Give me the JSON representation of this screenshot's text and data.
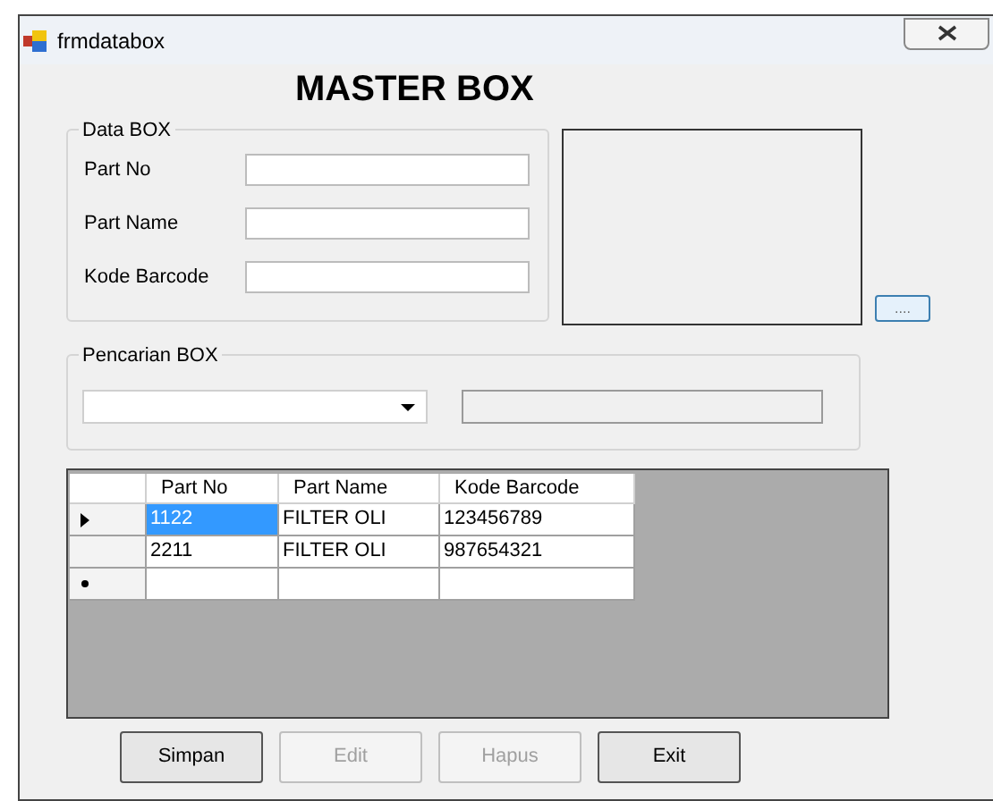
{
  "window": {
    "title": "frmdatabox"
  },
  "heading": "MASTER BOX",
  "data_group": {
    "title": "Data BOX",
    "fields": [
      {
        "label": "Part No"
      },
      {
        "label": "Part Name"
      },
      {
        "label": "Kode Barcode"
      }
    ]
  },
  "browse_button": "....",
  "search_group": {
    "title": "Pencarian BOX",
    "text_disabled": true
  },
  "grid": {
    "columns": [
      "Part No",
      "Part Name",
      "Kode Barcode"
    ],
    "rows": [
      {
        "current": true,
        "new": false,
        "cells": [
          {
            "text": "1122",
            "selected": true
          },
          {
            "text": "FILTER OLI",
            "selected": false
          },
          {
            "text": "123456789",
            "selected": false
          }
        ]
      },
      {
        "current": false,
        "new": false,
        "cells": [
          {
            "text": "2211",
            "selected": false
          },
          {
            "text": "FILTER OLI",
            "selected": false
          },
          {
            "text": "987654321",
            "selected": false
          }
        ]
      },
      {
        "current": false,
        "new": true,
        "cells": [
          {
            "selected": false
          },
          {
            "selected": false
          },
          {
            "selected": false
          }
        ]
      }
    ]
  },
  "buttons": [
    {
      "label": "Simpan",
      "disabled": false
    },
    {
      "label": "Edit",
      "disabled": true
    },
    {
      "label": "Hapus",
      "disabled": true
    },
    {
      "label": "Exit",
      "disabled": false
    }
  ]
}
